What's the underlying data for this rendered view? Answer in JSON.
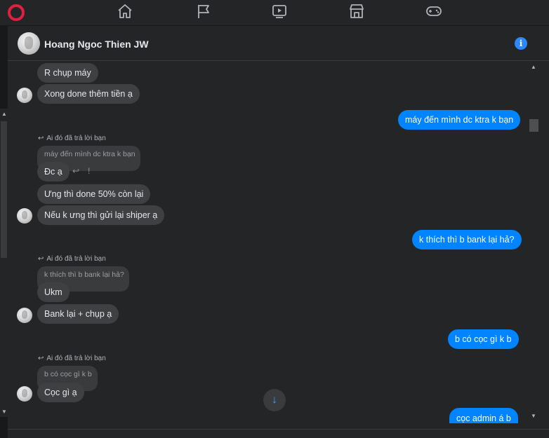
{
  "nav": {
    "items": [
      {
        "name": "home-icon"
      },
      {
        "name": "flag-icon"
      },
      {
        "name": "video-icon"
      },
      {
        "name": "marketplace-icon"
      },
      {
        "name": "gaming-icon"
      }
    ],
    "accent": "#e41e3f"
  },
  "header": {
    "contact_name": "Hoang Ngoc Thien JW",
    "info_label": "i"
  },
  "reply_label": "Ai đó đã trả lời bạn",
  "messages": {
    "m1": "R chụp máy",
    "m2": "Xong done thêm tiền ạ",
    "m3": "máy đến mình dc ktra k bạn",
    "q1": "máy đến mình dc ktra k bạn",
    "m4": "Đc ạ",
    "m5": "Ưng thì done 50% còn lại",
    "m6": "Nếu k ưng thì gửi lại shiper ạ",
    "m7": "k thích thì b bank lại hả?",
    "q2": "k thích thì b bank lại hả?",
    "m8": "Ukm",
    "m9": "Bank lại + chụp ạ",
    "m10": "b có cọc gì k b",
    "q3": "b có cọc gì k b",
    "m11": "Cọc gì ạ",
    "m12": "cọc admin á b"
  },
  "colors": {
    "outgoing": "#0084ff",
    "incoming": "#3e4042",
    "background": "#242526"
  }
}
